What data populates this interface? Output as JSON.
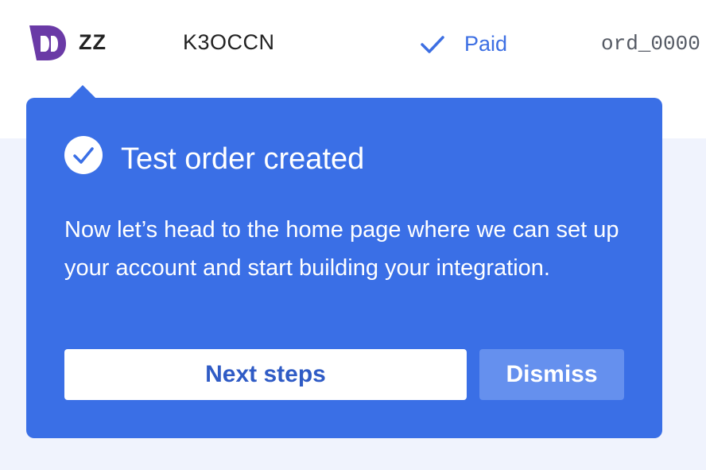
{
  "order_row": {
    "customer_name": "ZZ",
    "reference": "K3OCCN",
    "status": "Paid",
    "order_id": "ord_0000",
    "logo_icon": "brand-logo-icon",
    "status_icon": "checkmark-icon"
  },
  "popover": {
    "title": "Test order created",
    "title_icon": "check-circle-icon",
    "body": "Now let’s head to the home page where we can set up your account and start building your integration.",
    "primary_button": "Next steps",
    "secondary_button": "Dismiss"
  },
  "colors": {
    "accent": "#3a6fe6",
    "status_paid": "#3d6fe3",
    "brand_logo": "#6a3aa6",
    "page_background": "#f0f3fd"
  }
}
